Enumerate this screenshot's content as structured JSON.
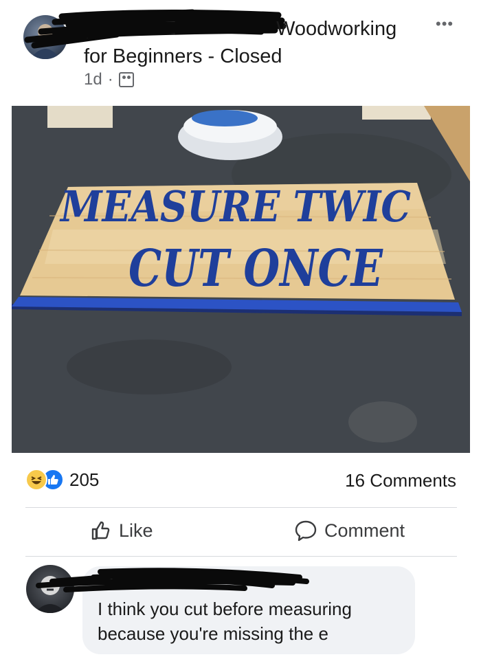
{
  "post": {
    "group_name_line1": "Woodworking",
    "group_name_line2": "for Beginners - Closed",
    "time": "1d",
    "separator": "·",
    "more_label": "•••"
  },
  "photo": {
    "sign_line1": "MEASURE TWIC",
    "sign_line2": "CUT ONCE"
  },
  "stats": {
    "reaction_count": "205",
    "comments_label": "16 Comments"
  },
  "actions": {
    "like_label": "Like",
    "comment_label": "Comment"
  },
  "comment": {
    "text_line1": "I think you cut before measuring",
    "text_line2": "because you're missing the e"
  },
  "colors": {
    "like_blue": "#1877f2",
    "haha_yellow": "#f7c94b",
    "sign_blue": "#1f3f9b",
    "bubble_bg": "#f0f2f5"
  },
  "icons": {
    "reactions": [
      "haha-icon",
      "like-reaction-icon"
    ],
    "meta": "group-privacy-icon",
    "like": "thumbs-up-icon",
    "comment": "speech-bubble-icon"
  }
}
